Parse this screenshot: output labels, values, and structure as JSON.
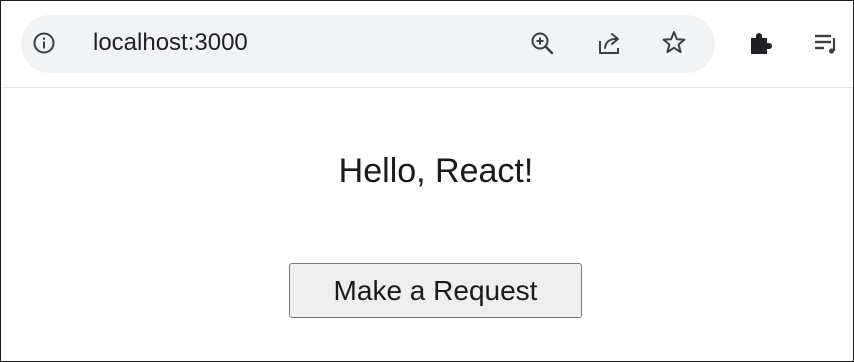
{
  "browser": {
    "address_bar": {
      "url": "localhost:3000",
      "left_icon": "info-icon"
    },
    "toolbar_icons": [
      "zoom-in-icon",
      "share-icon",
      "bookmark-star-icon",
      "extensions-puzzle-icon",
      "reading-list-icon"
    ]
  },
  "page": {
    "heading": "Hello, React!",
    "button_label": "Make a Request"
  },
  "colors": {
    "omnibox_bg": "#f1f3f4",
    "button_bg": "#efefef",
    "button_border": "#767676",
    "text": "#1a1a1a"
  }
}
